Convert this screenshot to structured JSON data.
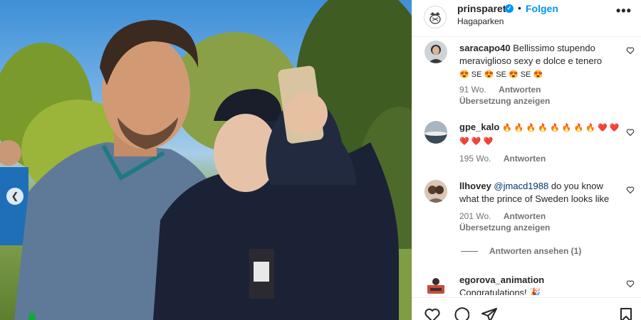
{
  "post": {
    "username": "prinsparet",
    "verified_mark": "✓",
    "separator": "•",
    "follow_label": "Folgen",
    "location": "Hagaparken",
    "more_label": "•••",
    "nav_prev": "❮"
  },
  "comments": [
    {
      "username": "saracapo40",
      "text": "Bellissimo stupendo meraviglioso sexy e dolce e tenero",
      "emoji_line": "😍 SE 😍 SE 😍 SE 😍",
      "time": "91 Wo.",
      "reply_label": "Antworten",
      "translate_label": "Übersetzung anzeigen"
    },
    {
      "username": "gpe_kalo",
      "text": "🔥 🔥 🔥 🔥 🔥 🔥 🔥 🔥 ❤️ ❤️ ❤️ ❤️ ❤️",
      "time": "195 Wo.",
      "reply_label": "Antworten"
    },
    {
      "username": "llhovey",
      "mention": "@jmacd1988",
      "text": "do you know what the prince of Sweden looks like",
      "time": "201 Wo.",
      "reply_label": "Antworten",
      "translate_label": "Übersetzung anzeigen",
      "view_replies": "Antworten ansehen (1)"
    },
    {
      "username": "egorova_animation",
      "text": "Congratulations! 🎉"
    }
  ],
  "icons": {
    "like": "heart-icon",
    "comment": "comment-icon",
    "share": "send-icon",
    "save": "bookmark-icon"
  },
  "colors": {
    "link_blue": "#0095f6",
    "mention_blue": "#00376b",
    "meta_gray": "#737373"
  }
}
